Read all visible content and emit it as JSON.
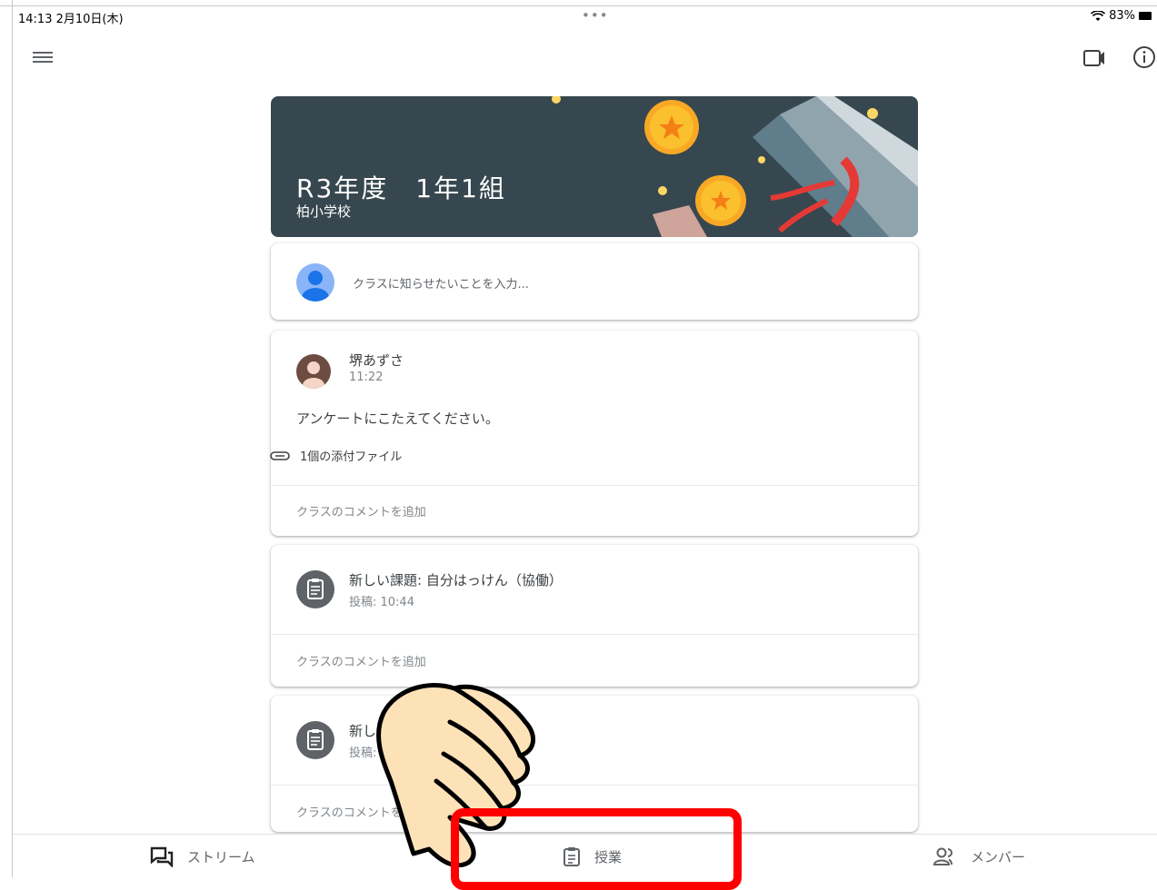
{
  "status_bar": {
    "time": "14:13  2月10日(木)",
    "dots": "•••",
    "battery": "83%"
  },
  "toolbar": {
    "menu_icon": "hamburger-menu-icon",
    "video_icon": "video-call-icon",
    "info_icon": "info-icon"
  },
  "banner": {
    "title": "R3年度　1年1組",
    "subtitle": "柏小学校"
  },
  "announce": {
    "placeholder": "クラスに知らせたいことを入力..."
  },
  "posts": [
    {
      "author": "堺あずさ",
      "time": "11:22",
      "body": "アンケートにこたえてください。",
      "attachment": "1個の添付ファイル",
      "comment": "クラスのコメントを追加"
    },
    {
      "title": "新しい課題: 自分はっけん（協働）",
      "time": "投稿: 10:44",
      "comment": "クラスのコメントを追加"
    },
    {
      "title": "新し",
      "time": "投稿:",
      "comment": "クラスのコメントを"
    }
  ],
  "bottom_nav": {
    "stream": "ストリーム",
    "classwork": "授業",
    "people": "メンバー"
  },
  "colors": {
    "banner": "#37474f",
    "accent_blue": "#8ab4f8",
    "highlight": "#ff0000"
  }
}
